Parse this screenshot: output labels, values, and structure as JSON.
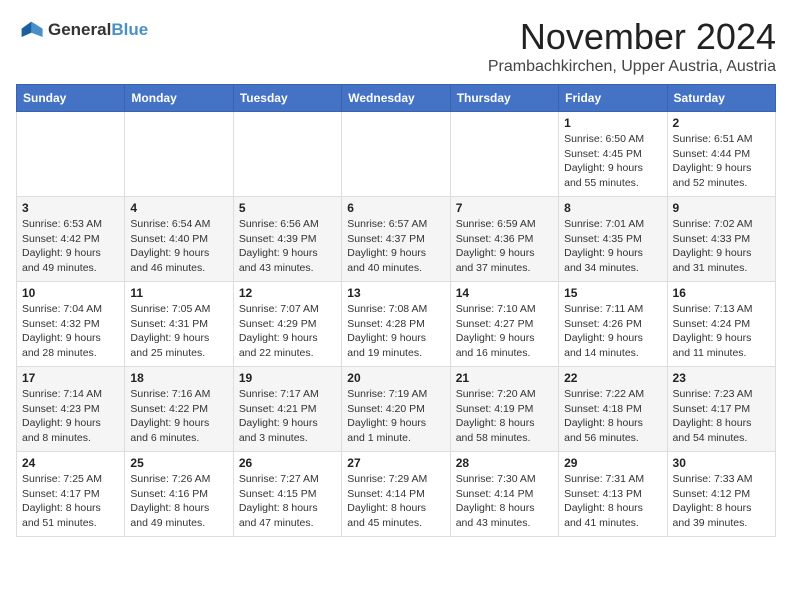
{
  "logo": {
    "line1": "General",
    "line2": "Blue"
  },
  "title": "November 2024",
  "location": "Prambachkirchen, Upper Austria, Austria",
  "weekdays": [
    "Sunday",
    "Monday",
    "Tuesday",
    "Wednesday",
    "Thursday",
    "Friday",
    "Saturday"
  ],
  "weeks": [
    [
      {
        "day": "",
        "info": ""
      },
      {
        "day": "",
        "info": ""
      },
      {
        "day": "",
        "info": ""
      },
      {
        "day": "",
        "info": ""
      },
      {
        "day": "",
        "info": ""
      },
      {
        "day": "1",
        "info": "Sunrise: 6:50 AM\nSunset: 4:45 PM\nDaylight: 9 hours and 55 minutes."
      },
      {
        "day": "2",
        "info": "Sunrise: 6:51 AM\nSunset: 4:44 PM\nDaylight: 9 hours and 52 minutes."
      }
    ],
    [
      {
        "day": "3",
        "info": "Sunrise: 6:53 AM\nSunset: 4:42 PM\nDaylight: 9 hours and 49 minutes."
      },
      {
        "day": "4",
        "info": "Sunrise: 6:54 AM\nSunset: 4:40 PM\nDaylight: 9 hours and 46 minutes."
      },
      {
        "day": "5",
        "info": "Sunrise: 6:56 AM\nSunset: 4:39 PM\nDaylight: 9 hours and 43 minutes."
      },
      {
        "day": "6",
        "info": "Sunrise: 6:57 AM\nSunset: 4:37 PM\nDaylight: 9 hours and 40 minutes."
      },
      {
        "day": "7",
        "info": "Sunrise: 6:59 AM\nSunset: 4:36 PM\nDaylight: 9 hours and 37 minutes."
      },
      {
        "day": "8",
        "info": "Sunrise: 7:01 AM\nSunset: 4:35 PM\nDaylight: 9 hours and 34 minutes."
      },
      {
        "day": "9",
        "info": "Sunrise: 7:02 AM\nSunset: 4:33 PM\nDaylight: 9 hours and 31 minutes."
      }
    ],
    [
      {
        "day": "10",
        "info": "Sunrise: 7:04 AM\nSunset: 4:32 PM\nDaylight: 9 hours and 28 minutes."
      },
      {
        "day": "11",
        "info": "Sunrise: 7:05 AM\nSunset: 4:31 PM\nDaylight: 9 hours and 25 minutes."
      },
      {
        "day": "12",
        "info": "Sunrise: 7:07 AM\nSunset: 4:29 PM\nDaylight: 9 hours and 22 minutes."
      },
      {
        "day": "13",
        "info": "Sunrise: 7:08 AM\nSunset: 4:28 PM\nDaylight: 9 hours and 19 minutes."
      },
      {
        "day": "14",
        "info": "Sunrise: 7:10 AM\nSunset: 4:27 PM\nDaylight: 9 hours and 16 minutes."
      },
      {
        "day": "15",
        "info": "Sunrise: 7:11 AM\nSunset: 4:26 PM\nDaylight: 9 hours and 14 minutes."
      },
      {
        "day": "16",
        "info": "Sunrise: 7:13 AM\nSunset: 4:24 PM\nDaylight: 9 hours and 11 minutes."
      }
    ],
    [
      {
        "day": "17",
        "info": "Sunrise: 7:14 AM\nSunset: 4:23 PM\nDaylight: 9 hours and 8 minutes."
      },
      {
        "day": "18",
        "info": "Sunrise: 7:16 AM\nSunset: 4:22 PM\nDaylight: 9 hours and 6 minutes."
      },
      {
        "day": "19",
        "info": "Sunrise: 7:17 AM\nSunset: 4:21 PM\nDaylight: 9 hours and 3 minutes."
      },
      {
        "day": "20",
        "info": "Sunrise: 7:19 AM\nSunset: 4:20 PM\nDaylight: 9 hours and 1 minute."
      },
      {
        "day": "21",
        "info": "Sunrise: 7:20 AM\nSunset: 4:19 PM\nDaylight: 8 hours and 58 minutes."
      },
      {
        "day": "22",
        "info": "Sunrise: 7:22 AM\nSunset: 4:18 PM\nDaylight: 8 hours and 56 minutes."
      },
      {
        "day": "23",
        "info": "Sunrise: 7:23 AM\nSunset: 4:17 PM\nDaylight: 8 hours and 54 minutes."
      }
    ],
    [
      {
        "day": "24",
        "info": "Sunrise: 7:25 AM\nSunset: 4:17 PM\nDaylight: 8 hours and 51 minutes."
      },
      {
        "day": "25",
        "info": "Sunrise: 7:26 AM\nSunset: 4:16 PM\nDaylight: 8 hours and 49 minutes."
      },
      {
        "day": "26",
        "info": "Sunrise: 7:27 AM\nSunset: 4:15 PM\nDaylight: 8 hours and 47 minutes."
      },
      {
        "day": "27",
        "info": "Sunrise: 7:29 AM\nSunset: 4:14 PM\nDaylight: 8 hours and 45 minutes."
      },
      {
        "day": "28",
        "info": "Sunrise: 7:30 AM\nSunset: 4:14 PM\nDaylight: 8 hours and 43 minutes."
      },
      {
        "day": "29",
        "info": "Sunrise: 7:31 AM\nSunset: 4:13 PM\nDaylight: 8 hours and 41 minutes."
      },
      {
        "day": "30",
        "info": "Sunrise: 7:33 AM\nSunset: 4:12 PM\nDaylight: 8 hours and 39 minutes."
      }
    ]
  ]
}
